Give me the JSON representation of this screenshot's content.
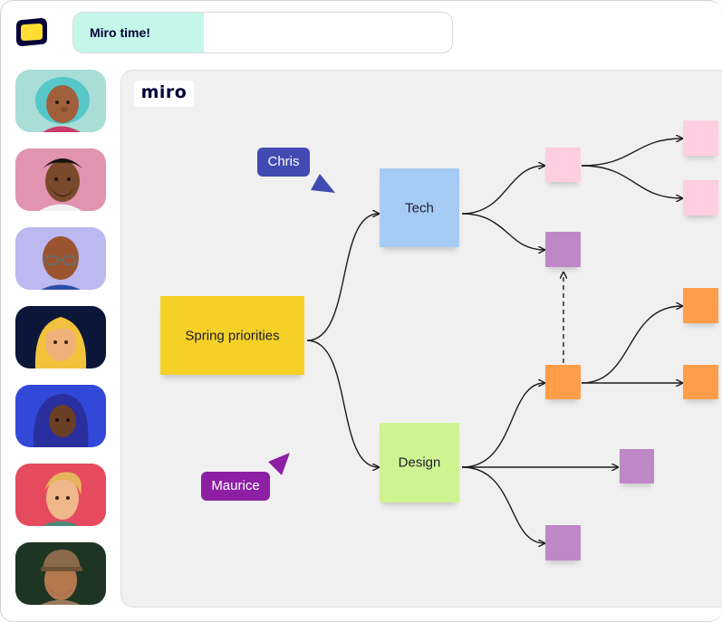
{
  "app": {
    "title": "Miro time!",
    "logo_icon": "miro-yellow-logo-icon",
    "accent": "#c4f7e9"
  },
  "board": {
    "brand": "miro",
    "central": {
      "label": "Spring priorities",
      "color": "#f5d128"
    },
    "branches": [
      {
        "label": "Tech",
        "color": "#a6ccf5"
      },
      {
        "label": "Design",
        "color": "#d0f391"
      }
    ],
    "cursors": [
      {
        "name": "Chris",
        "color": "#414bb2"
      },
      {
        "name": "Maurice",
        "color": "#8c1fa3"
      }
    ],
    "note_colors": {
      "pink": "#ffcee0",
      "violet": "#be88c7",
      "orange": "#ff9d48"
    }
  },
  "participants": [
    {
      "avatar": "avatar-teal-hair",
      "bg": "#a8ddd8"
    },
    {
      "avatar": "avatar-beard-man",
      "bg": "#e293b0"
    },
    {
      "avatar": "avatar-glasses",
      "bg": "#bcb8f0"
    },
    {
      "avatar": "avatar-blonde-woman",
      "bg": "#0b1638"
    },
    {
      "avatar": "avatar-hijab-woman",
      "bg": "#3148d8"
    },
    {
      "avatar": "avatar-blonde-man",
      "bg": "#e64a5e"
    },
    {
      "avatar": "avatar-cap-man",
      "bg": "#1f3524"
    }
  ]
}
